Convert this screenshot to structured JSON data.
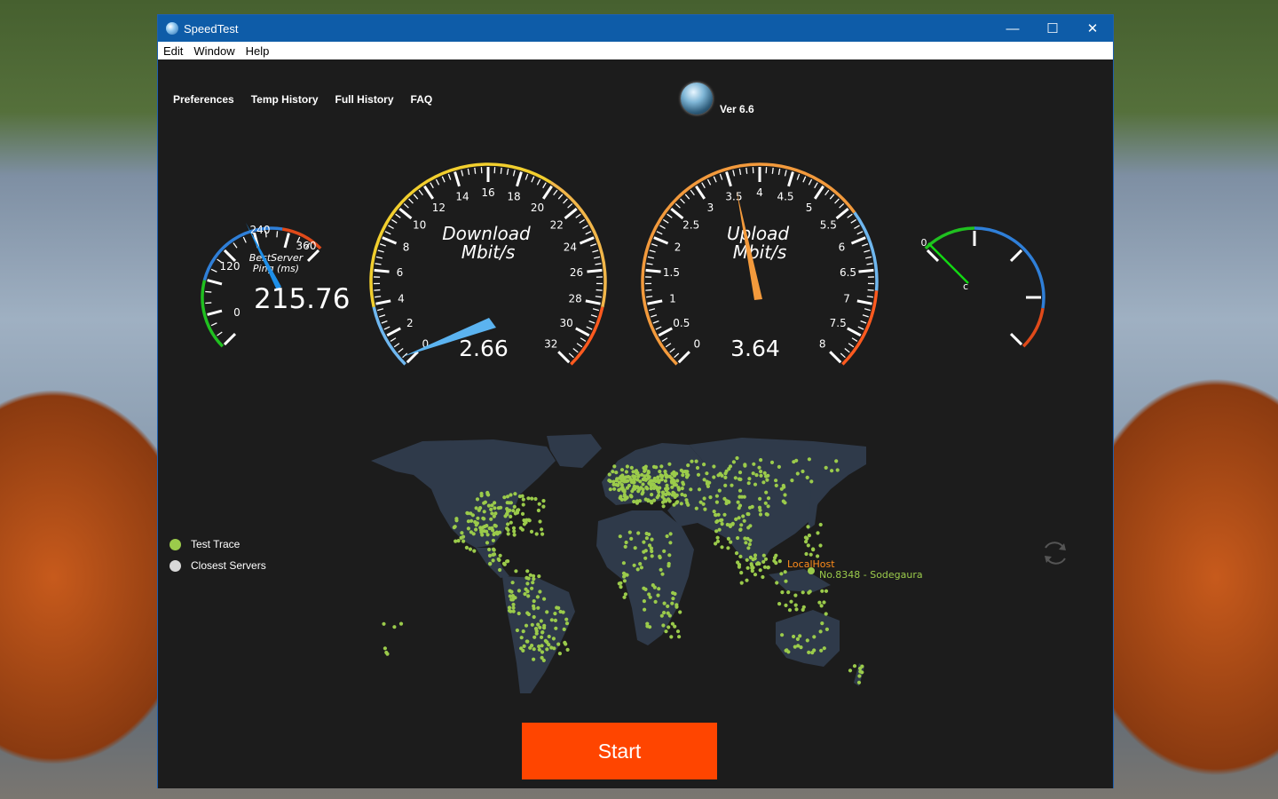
{
  "window": {
    "title": "SpeedTest",
    "controls": {
      "minimize": "—",
      "maximize": "☐",
      "close": "✕"
    }
  },
  "menu": [
    "Edit",
    "Window",
    "Help"
  ],
  "nav": [
    "Preferences",
    "Temp History",
    "Full History",
    "FAQ"
  ],
  "version": "Ver 6.6",
  "ping_gauge": {
    "title_line1": "BestServer",
    "title_line2": "Ping (ms)",
    "value": "215.76",
    "tick_labels": [
      "0",
      "120",
      "240",
      "360"
    ]
  },
  "download_gauge": {
    "title_line1": "Download",
    "title_line2": "Mbit/s",
    "value": "2.66",
    "tick_labels": [
      "0",
      "2",
      "4",
      "6",
      "8",
      "10",
      "12",
      "14",
      "16",
      "18",
      "20",
      "22",
      "24",
      "26",
      "28",
      "30",
      "32"
    ]
  },
  "upload_gauge": {
    "title_line1": "Upload",
    "title_line2": "Mbit/s",
    "value": "3.64",
    "tick_labels": [
      "0",
      "0.5",
      "1",
      "1.5",
      "2",
      "2.5",
      "3",
      "3.5",
      "4",
      "4.5",
      "5",
      "5.5",
      "6",
      "6.5",
      "7",
      "7.5",
      "8"
    ]
  },
  "small_gauge": {
    "label_zero": "0",
    "label_c": "c"
  },
  "map": {
    "localhost_label": "LocalHost",
    "server_label": "No.8348 - Sodegaura"
  },
  "legend": [
    {
      "label": "Test Trace",
      "color": "#9bcb4b"
    },
    {
      "label": "Closest Servers",
      "color": "#d8d8d8"
    }
  ],
  "start_button": "Start",
  "colors": {
    "accent": "#ff4500",
    "titlebar": "#0e5ca8",
    "dot": "#9bcb4b",
    "download_needle": "#5bb3f0",
    "upload_needle": "#f39a3c",
    "ping_needle": "#1e8fe8"
  }
}
